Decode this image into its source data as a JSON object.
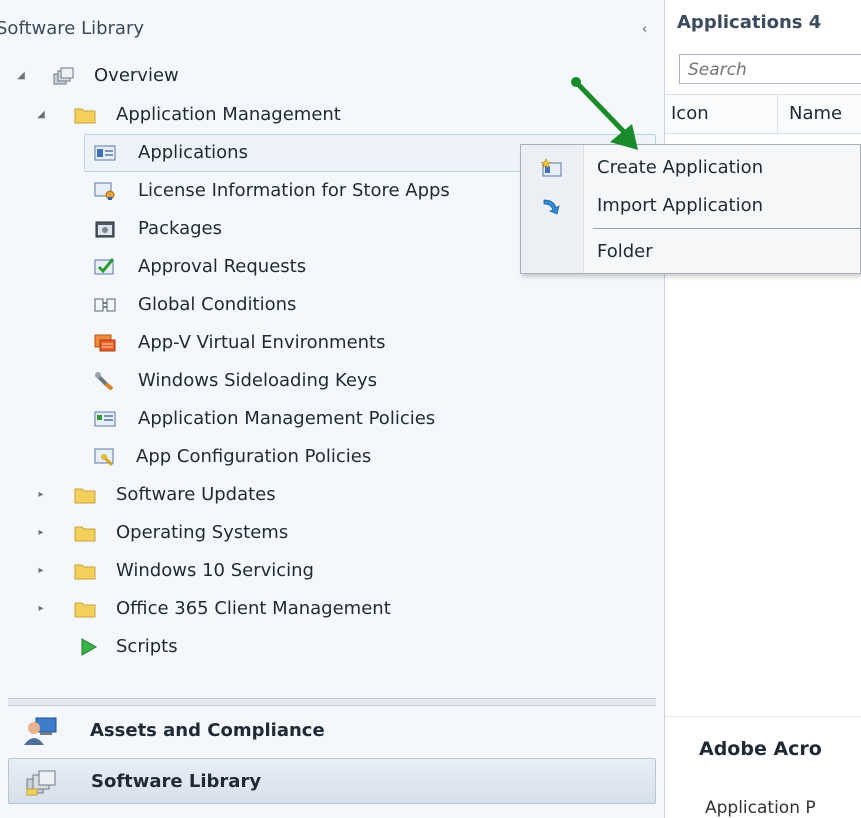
{
  "nav": {
    "title": "Software Library",
    "collapse_glyph": "‹",
    "tree": [
      {
        "label": "Overview",
        "icon": "overview-icon",
        "expander": "◢"
      },
      {
        "label": "Application Management",
        "icon": "folder-icon",
        "expander": "◢"
      },
      {
        "label": "Applications",
        "icon": "applications-icon"
      },
      {
        "label": "License Information for Store Apps",
        "icon": "license-info-icon"
      },
      {
        "label": "Packages",
        "icon": "packages-icon"
      },
      {
        "label": "Approval Requests",
        "icon": "approval-requests-icon"
      },
      {
        "label": "Global Conditions",
        "icon": "global-conditions-icon"
      },
      {
        "label": "App-V Virtual Environments",
        "icon": "appv-environments-icon"
      },
      {
        "label": "Windows Sideloading Keys",
        "icon": "sideloading-keys-icon"
      },
      {
        "label": "Application Management Policies",
        "icon": "management-policies-icon"
      },
      {
        "label": "App Configuration Policies",
        "icon": "configuration-policies-icon"
      },
      {
        "label": "Software Updates",
        "icon": "folder-icon",
        "expander": "▸"
      },
      {
        "label": "Operating Systems",
        "icon": "folder-icon",
        "expander": "▸"
      },
      {
        "label": "Windows 10 Servicing",
        "icon": "folder-icon",
        "expander": "▸"
      },
      {
        "label": "Office 365 Client Management",
        "icon": "folder-icon",
        "expander": "▸"
      },
      {
        "label": "Scripts",
        "icon": "scripts-icon"
      }
    ]
  },
  "workspaces": [
    {
      "label": "Assets and Compliance",
      "icon": "assets-compliance-icon"
    },
    {
      "label": "Software Library",
      "icon": "software-library-icon",
      "active": true
    }
  ],
  "content": {
    "title": "Applications 4",
    "search_placeholder": "Search",
    "columns": [
      "Icon",
      "Name"
    ],
    "details_title": "Adobe Acro",
    "details_sub": "Application P"
  },
  "context_menu": {
    "items": [
      {
        "label": "Create Application",
        "icon": "create-application-icon"
      },
      {
        "label": "Import Application",
        "icon": "import-application-icon"
      },
      {
        "label": "Folder"
      }
    ]
  },
  "colors": {
    "annotation_arrow": "#1a8a2a",
    "folder": "#f3cf5c",
    "nav_background": "#f4f7fb"
  }
}
